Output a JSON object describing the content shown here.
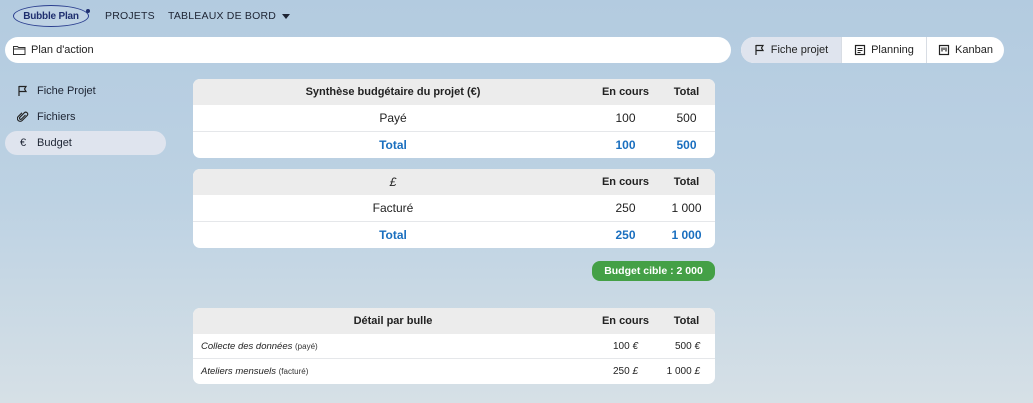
{
  "nav": {
    "logo": "Bubble Plan",
    "projets": "PROJETS",
    "tableaux": "TABLEAUX DE BORD"
  },
  "breadcrumb": {
    "label": "Plan d'action"
  },
  "views": {
    "fiche": "Fiche projet",
    "planning": "Planning",
    "kanban": "Kanban"
  },
  "sidebar": {
    "items": [
      {
        "label": "Fiche Projet",
        "icon": "flag-icon"
      },
      {
        "label": "Fichiers",
        "icon": "paperclip-icon"
      },
      {
        "label": "Budget",
        "icon": "euro-icon",
        "glyph": "€"
      }
    ]
  },
  "table1": {
    "headers": [
      "Synthèse budgétaire du projet (€)",
      "En cours",
      "Total"
    ],
    "rows": [
      [
        "Payé",
        "100",
        "500"
      ]
    ],
    "total": [
      "Total",
      "100",
      "500"
    ]
  },
  "table2": {
    "headers": [
      "£",
      "En cours",
      "Total"
    ],
    "rows": [
      [
        "Facturé",
        "250",
        "1 000"
      ]
    ],
    "total": [
      "Total",
      "250",
      "1 000"
    ]
  },
  "badge": "Budget cible : 2 000",
  "detail": {
    "headers": [
      "Détail par bulle",
      "En cours",
      "Total"
    ],
    "rows": [
      {
        "name": "Collecte des données",
        "tag": "(payé)",
        "en_cours": "100",
        "total": "500",
        "currency": "€"
      },
      {
        "name": "Ateliers mensuels",
        "tag": "(facturé)",
        "en_cours": "250",
        "total": "1 000",
        "currency": "£"
      }
    ]
  },
  "colors": {
    "accent_blue": "#1a6fbf",
    "badge_green": "#44a046"
  }
}
